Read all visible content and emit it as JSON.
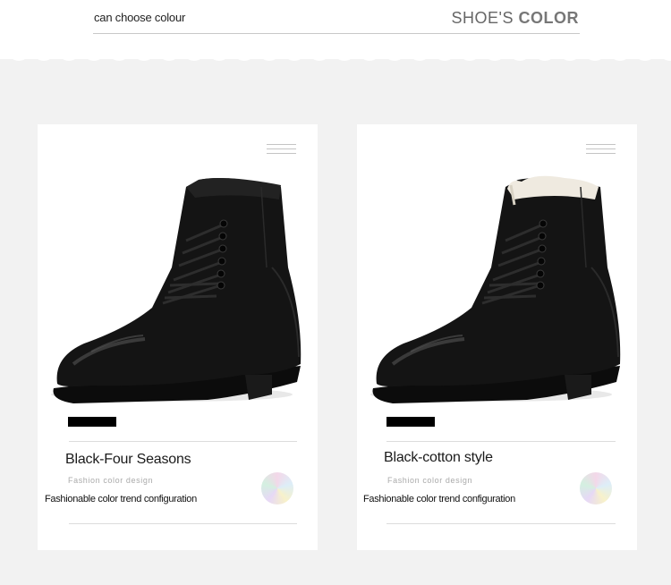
{
  "header": {
    "subtitle": "can choose colour",
    "title_light": "SHOE'S ",
    "title_bold": "COLOR"
  },
  "cards": [
    {
      "name": "Black-Four Seasons",
      "design": "Fashion  color  design",
      "desc": "Fashionable color trend configuration",
      "lining": "dark"
    },
    {
      "name": "Black-cotton style",
      "design": "Fashion  color  design",
      "desc": "Fashionable color trend configuration",
      "lining": "fleece"
    }
  ],
  "colors": {
    "background": "#f2f2f2",
    "card": "#ffffff",
    "boot": "#111111"
  },
  "icons": [
    "menu-icon",
    "color-swatch-icon"
  ]
}
